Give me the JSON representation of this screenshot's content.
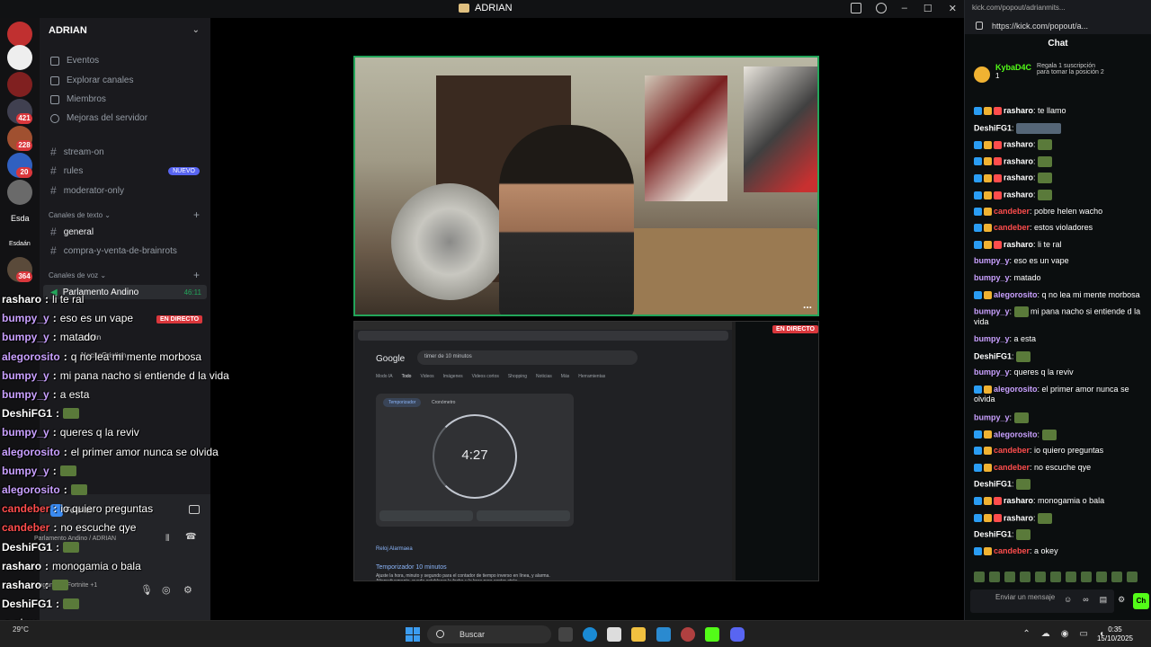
{
  "discord": {
    "window_title": "ADRIAN",
    "server_name": "ADRIAN",
    "rail_labels": {
      "esda": "Esda",
      "esdaan": "Esdaán"
    },
    "rail_badges": [
      "421",
      "228",
      "20",
      "364"
    ],
    "nav": [
      "Eventos",
      "Explorar canales",
      "Miembros",
      "Mejoras del servidor"
    ],
    "channels_top": [
      {
        "name": "stream-on"
      },
      {
        "name": "rules",
        "badge": "NUEVO"
      },
      {
        "name": "moderator-only"
      }
    ],
    "cat_text": "Canales de texto",
    "text_channels": [
      "general",
      "compra-y-venta-de-brainrots"
    ],
    "cat_voice": "Canales de voz",
    "voice_channel": {
      "name": "Parlamento Andino",
      "time": "46:11"
    },
    "voice_users": [
      "adrián",
      "NachoCristian"
    ],
    "live_badge": "EN DIRECTO",
    "activity": "Fortnite",
    "voice_status": "Parlamento Andino / ADRIAN",
    "user_status": "Jugando a Fortnite +1",
    "stage_more": "..."
  },
  "overlay_chat": [
    {
      "user": "rasharo",
      "msg": "li te ral",
      "color": "#ffffff"
    },
    {
      "user": "bumpy_y",
      "msg": "eso es un vape",
      "color": "#c9a0ff"
    },
    {
      "user": "bumpy_y",
      "msg": "matado",
      "color": "#c9a0ff"
    },
    {
      "user": "alegorosito",
      "msg": "q no lea mi mente morbosa",
      "color": "#c9a0ff"
    },
    {
      "user": "bumpy_y",
      "msg": "mi pana nacho si entiende d la vida",
      "color": "#c9a0ff"
    },
    {
      "user": "bumpy_y",
      "msg": "a esta",
      "color": "#c9a0ff"
    },
    {
      "user": "DeshiFG1",
      "msg": "",
      "color": "#ffffff"
    },
    {
      "user": "bumpy_y",
      "msg": "queres q la reviv",
      "color": "#c9a0ff"
    },
    {
      "user": "alegorosito",
      "msg": "el primer amor nunca se olvida",
      "color": "#c9a0ff"
    },
    {
      "user": "bumpy_y",
      "msg": "",
      "color": "#c9a0ff"
    },
    {
      "user": "alegorosito",
      "msg": "",
      "color": "#c9a0ff"
    },
    {
      "user": "candeber",
      "msg": "io quiero preguntas",
      "color": "#ff4d4d"
    },
    {
      "user": "candeber",
      "msg": "no escuche qye",
      "color": "#ff4d4d"
    },
    {
      "user": "DeshiFG1",
      "msg": "",
      "color": "#ffffff"
    },
    {
      "user": "rasharo",
      "msg": "monogamia o bala",
      "color": "#ffffff"
    },
    {
      "user": "rasharo",
      "msg": "",
      "color": "#ffffff"
    },
    {
      "user": "DeshiFG1",
      "msg": "",
      "color": "#ffffff"
    },
    {
      "user": "",
      "msg": "a okey",
      "color": "#ffffff"
    }
  ],
  "screen_share": {
    "search_query": "timer de 10 minutos",
    "google": "Google",
    "filters": [
      "Modo IA",
      "Todo",
      "Videos",
      "Imágenes",
      "Videos cortos",
      "Shopping",
      "Noticias",
      "Más",
      "Herramientas"
    ],
    "chip_timer": "Temporizador",
    "chip_stopwatch": "Cronómetro",
    "timer_value": "4:27",
    "result_site": "Reloj Alarmaea",
    "result_title": "Temporizador 10 minutos",
    "result_desc": "Ajuste la hora, minuto y segundo para el contador de tiempo inverso en línea, y alarma. Alternativamente, puede establecer la fecha y la hora para contar atrás ...",
    "live_badge": "EN DIRECTO"
  },
  "kick": {
    "url": "https://kick.com/popout/a...",
    "title_url": "kick.com/popout/adrianmits...",
    "header": "Chat",
    "pinned_user": "KybaD4C",
    "pinned_num": "1",
    "pinned_msg": "Regala 1 suscripción para tomar la posición 2",
    "input_placeholder": "Enviar un mensaje",
    "send": "Ch",
    "messages": [
      {
        "user": "rasharo",
        "msg": "te llamo",
        "color": "#ffffff",
        "badges": true,
        "emote": false
      },
      {
        "user": "DeshiFG1",
        "msg": "",
        "color": "#ffffff",
        "badges": false,
        "emote": true
      },
      {
        "user": "rasharo",
        "msg": "",
        "color": "#ffffff",
        "badges": true,
        "emote": true
      },
      {
        "user": "rasharo",
        "msg": "",
        "color": "#ffffff",
        "badges": true,
        "emote": true
      },
      {
        "user": "rasharo",
        "msg": "",
        "color": "#ffffff",
        "badges": true,
        "emote": true
      },
      {
        "user": "rasharo",
        "msg": "",
        "color": "#ffffff",
        "badges": true,
        "emote": true
      },
      {
        "user": "candeber",
        "msg": "pobre helen wacho",
        "color": "#ff4d4d",
        "badges": true,
        "emote": false
      },
      {
        "user": "candeber",
        "msg": "estos violadores",
        "color": "#ff4d4d",
        "badges": true,
        "emote": false
      },
      {
        "user": "rasharo",
        "msg": "li te ral",
        "color": "#ffffff",
        "badges": true,
        "emote": false
      },
      {
        "user": "bumpy_y",
        "msg": "eso es un vape",
        "color": "#c9a0ff",
        "badges": false,
        "emote": false
      },
      {
        "user": "bumpy_y",
        "msg": "matado",
        "color": "#c9a0ff",
        "badges": false,
        "emote": false
      },
      {
        "user": "alegorosito",
        "msg": "q no lea mi mente morbosa",
        "color": "#c9a0ff",
        "badges": true,
        "emote": false
      },
      {
        "user": "bumpy_y",
        "msg": "mi pana nacho si entiende d la vida",
        "color": "#c9a0ff",
        "badges": false,
        "emote": true,
        "tall": true
      },
      {
        "user": "bumpy_y",
        "msg": "a esta",
        "color": "#c9a0ff",
        "badges": false,
        "emote": false
      },
      {
        "user": "DeshiFG1",
        "msg": "",
        "color": "#ffffff",
        "badges": false,
        "emote": true
      },
      {
        "user": "bumpy_y",
        "msg": "queres q la reviv",
        "color": "#c9a0ff",
        "badges": false,
        "emote": false
      },
      {
        "user": "alegorosito",
        "msg": "el primer amor nunca se olvida",
        "color": "#c9a0ff",
        "badges": true,
        "emote": false,
        "tall": true
      },
      {
        "user": "bumpy_y",
        "msg": "",
        "color": "#c9a0ff",
        "badges": false,
        "emote": true
      },
      {
        "user": "alegorosito",
        "msg": "",
        "color": "#c9a0ff",
        "badges": true,
        "emote": true
      },
      {
        "user": "candeber",
        "msg": "io quiero preguntas",
        "color": "#ff4d4d",
        "badges": true,
        "emote": false
      },
      {
        "user": "candeber",
        "msg": "no escuche qye",
        "color": "#ff4d4d",
        "badges": true,
        "emote": false
      },
      {
        "user": "DeshiFG1",
        "msg": "",
        "color": "#ffffff",
        "badges": false,
        "emote": true
      },
      {
        "user": "rasharo",
        "msg": "monogamia o bala",
        "color": "#ffffff",
        "badges": true,
        "emote": false
      },
      {
        "user": "rasharo",
        "msg": "",
        "color": "#ffffff",
        "badges": true,
        "emote": true
      },
      {
        "user": "DeshiFG1",
        "msg": "",
        "color": "#ffffff",
        "badges": false,
        "emote": true
      },
      {
        "user": "candeber",
        "msg": "a okey",
        "color": "#ff4d4d",
        "badges": true,
        "emote": false
      }
    ]
  },
  "taskbar": {
    "search": "Buscar",
    "weather_temp": "29°C",
    "time": "0:35",
    "date": "15/10/2025"
  }
}
